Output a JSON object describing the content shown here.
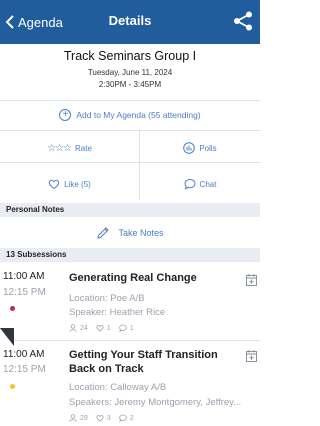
{
  "nav": {
    "back_label": "Agenda",
    "title": "Details"
  },
  "header": {
    "title": "Track Seminars Group I",
    "date": "Tuesday, June 11, 2024",
    "time": "2:30PM - 3:45PM"
  },
  "actions": {
    "add_agenda": "Add to My Agenda (55 attending)",
    "rate": "Rate",
    "polls": "Polls",
    "like": "Like (5)",
    "chat": "Chat"
  },
  "notes": {
    "section_label": "Personal Notes",
    "take_notes": "Take Notes"
  },
  "subsessions": {
    "header": "13 Subsessions",
    "items": [
      {
        "start": "11:00 AM",
        "end": "12:15 PM",
        "title_line1": "Generating Real Change",
        "title_line2": "",
        "location": "Location: Poe A/B",
        "speaker": "Speaker: Heather Rice",
        "attendees": "24",
        "likes": "1",
        "comments": "1",
        "dot_color": "#c0285a"
      },
      {
        "start": "11:00 AM",
        "end": "12:15 PM",
        "title_line1": "Getting Your Staff Transition",
        "title_line2": "Back on Track",
        "location": "Location: Calloway A/B",
        "speaker": "Speakers: Jeremy Montgomery, Jeffrey...",
        "attendees": "29",
        "likes": "3",
        "comments": "2",
        "dot_color": "#f2c230"
      }
    ]
  },
  "colors": {
    "nav_bg": "#215c9c",
    "accent": "#4a7fc8",
    "muted": "#9aa3ad"
  },
  "icons": [
    "chevron-left-icon",
    "share-icon",
    "plus-circle-icon",
    "star-icon",
    "poll-icon",
    "heart-icon",
    "chat-icon",
    "pencil-icon",
    "calendar-add-icon",
    "person-icon"
  ]
}
